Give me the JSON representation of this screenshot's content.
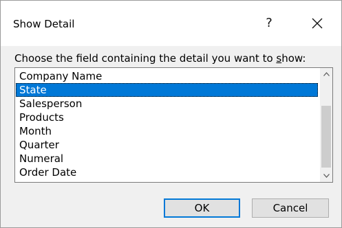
{
  "dialog": {
    "title": "Show Detail",
    "help_label": "?",
    "close_icon": "close-icon"
  },
  "prompt": {
    "before": "Choose the field containing the detail you want to ",
    "underlined": "s",
    "after": "how:"
  },
  "fields": {
    "items": [
      {
        "label": "Company Name",
        "selected": false
      },
      {
        "label": "State",
        "selected": true
      },
      {
        "label": "Salesperson",
        "selected": false
      },
      {
        "label": "Products",
        "selected": false
      },
      {
        "label": "Month",
        "selected": false
      },
      {
        "label": "Quarter",
        "selected": false
      },
      {
        "label": "Numeral",
        "selected": false
      },
      {
        "label": "Order Date",
        "selected": false
      }
    ],
    "scroll_up_icon": "chevron-up-icon",
    "scroll_down_icon": "chevron-down-icon"
  },
  "buttons": {
    "ok_label": "OK",
    "cancel_label": "Cancel"
  },
  "colors": {
    "selection": "#0078d7",
    "dialog_background": "#f0f0f0"
  }
}
